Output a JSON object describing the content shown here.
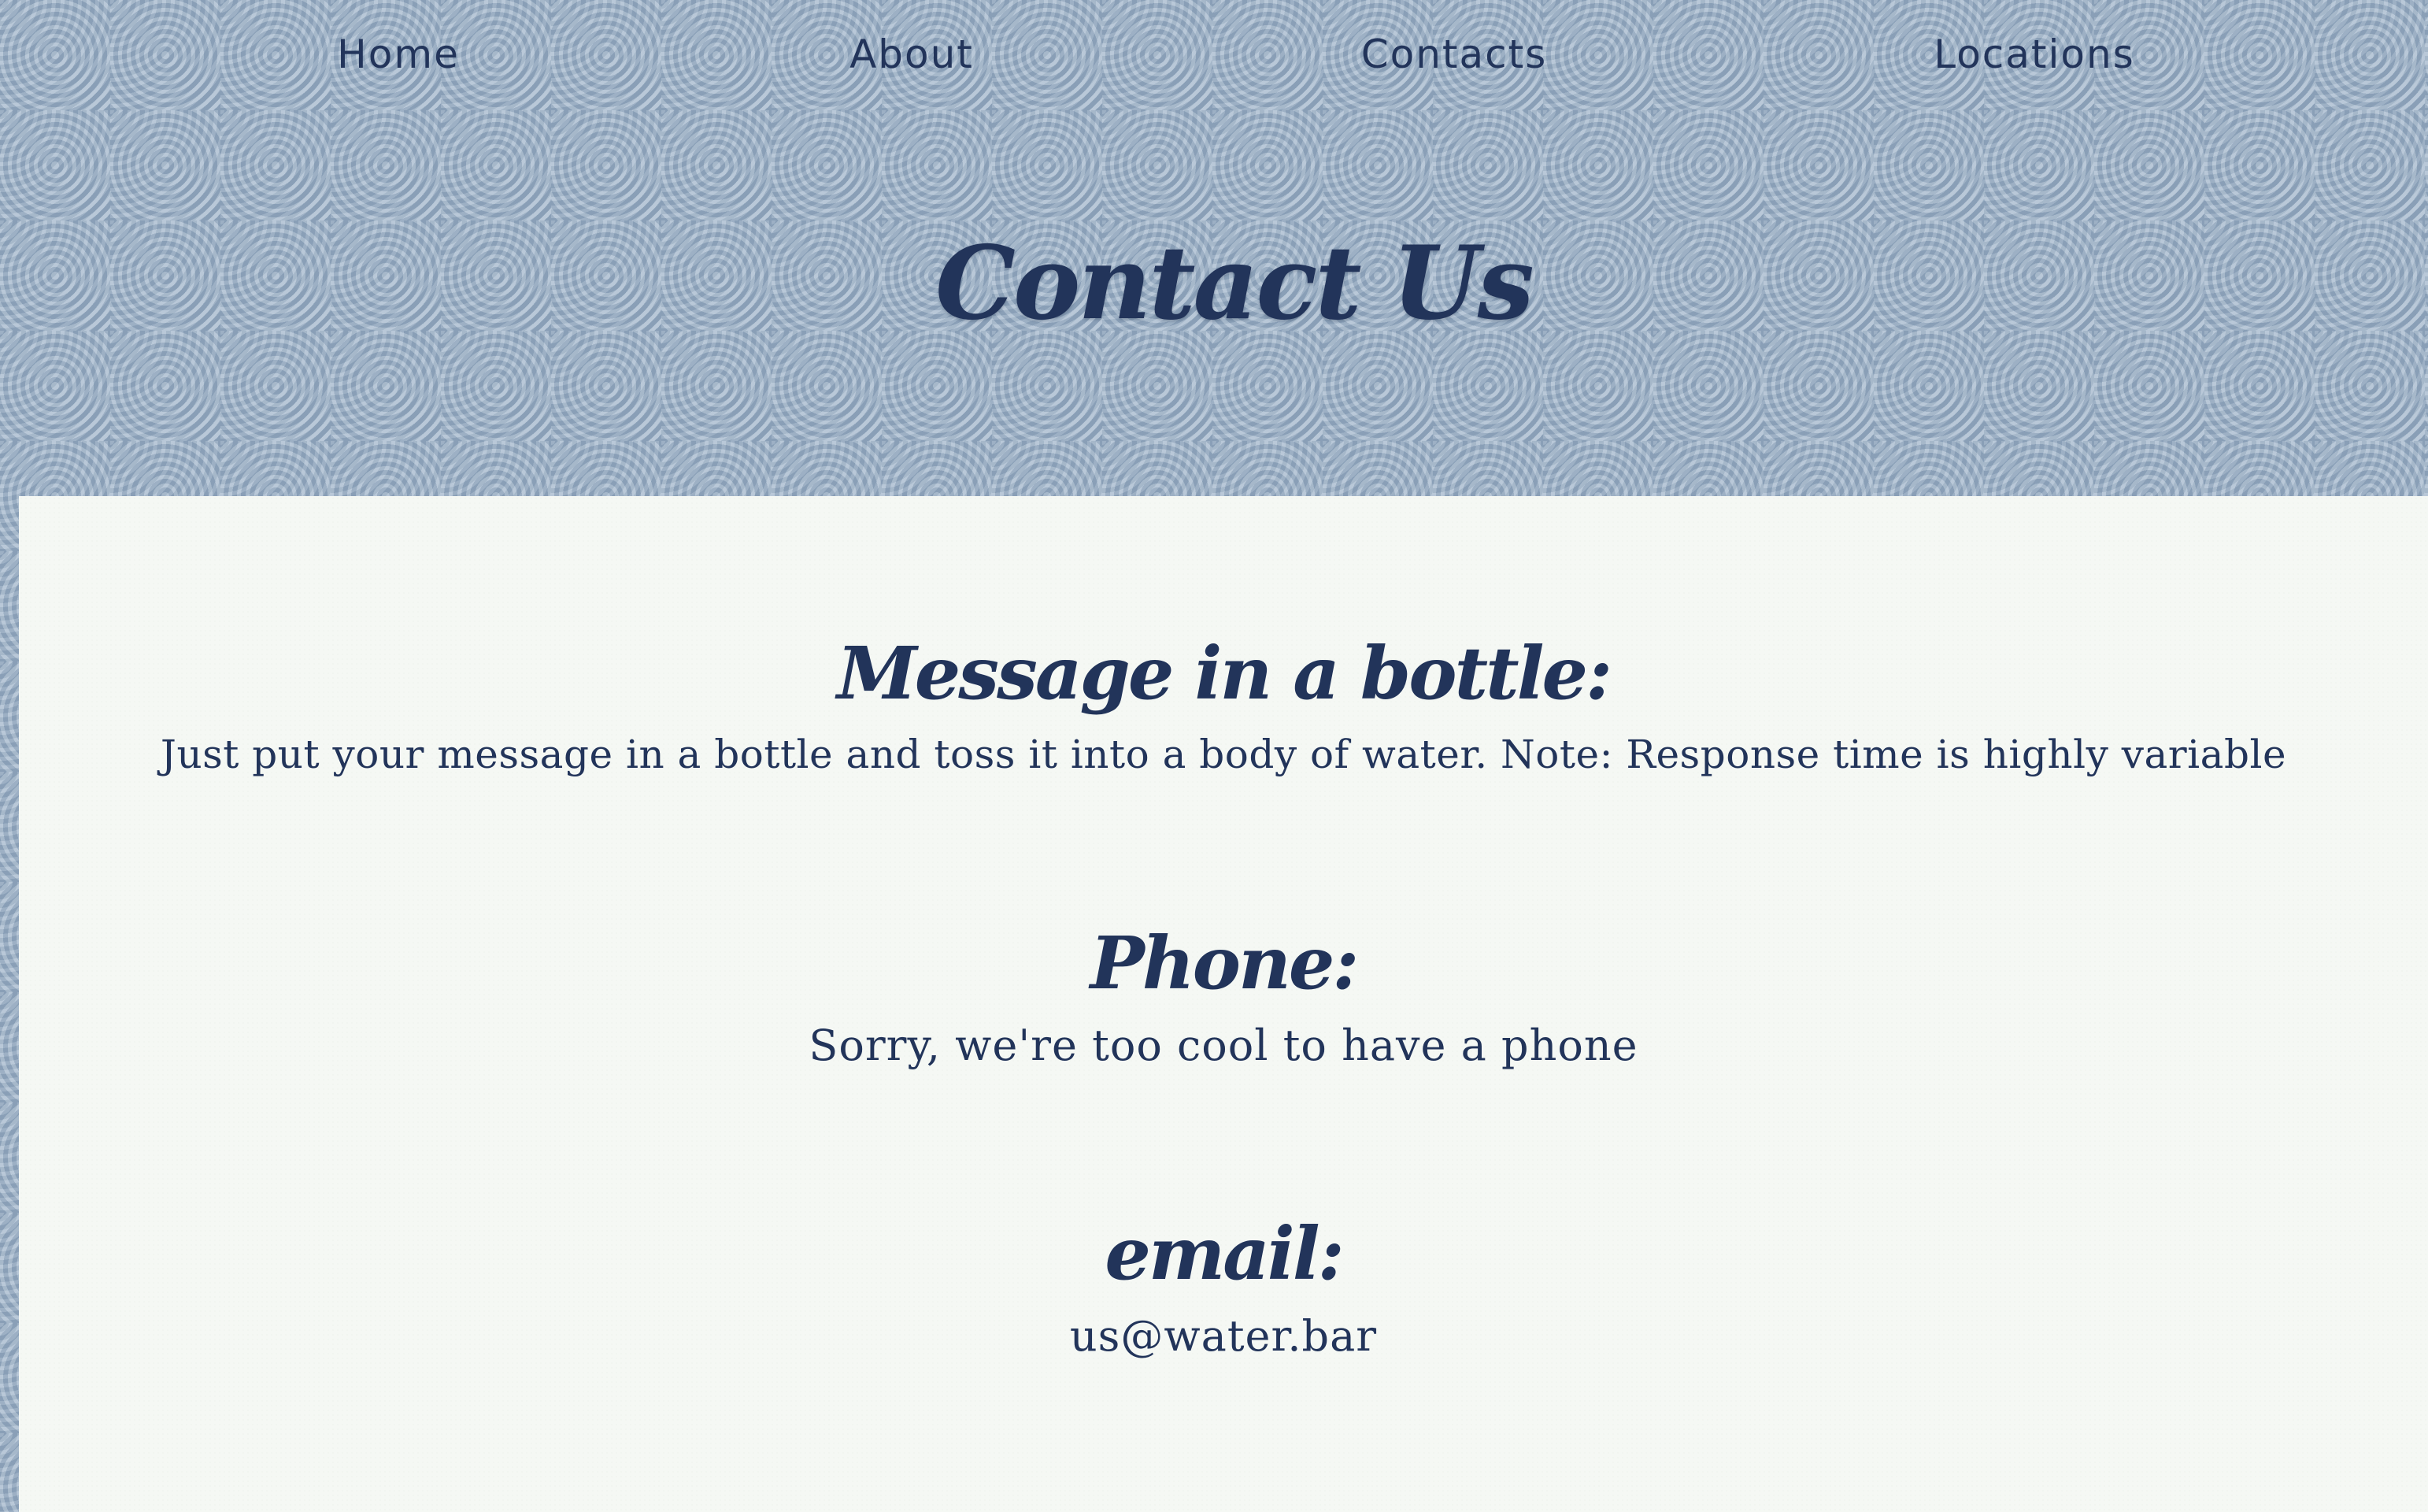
{
  "nav": {
    "items": [
      {
        "label": "Home"
      },
      {
        "label": "About"
      },
      {
        "label": "Contacts"
      },
      {
        "label": "Locations"
      }
    ]
  },
  "hero": {
    "title": "Contact Us"
  },
  "sections": {
    "bottle": {
      "heading": "Message in a bottle:",
      "text": "Just put your message in a bottle and toss it into a body of water. Note: Response time is highly variable"
    },
    "phone": {
      "heading": "Phone:",
      "text": "Sorry, we're too cool to have a phone"
    },
    "email": {
      "heading": "email:",
      "text": "us@water.bar"
    }
  },
  "colors": {
    "text": "#22345a",
    "header_background": "#9fb4c9",
    "content_background": "#f5f8f4"
  }
}
